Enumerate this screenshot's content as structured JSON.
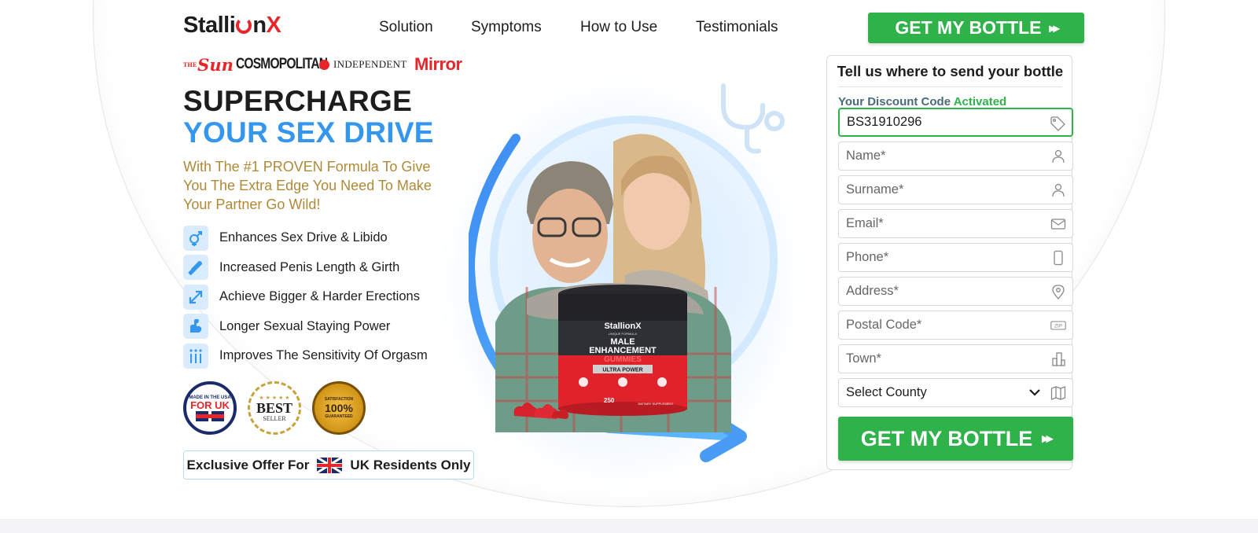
{
  "header": {
    "logo_main": "Stalli",
    "logo_o": "O",
    "logo_n": "n",
    "logo_x": "X",
    "nav": [
      "Solution",
      "Symptoms",
      "How to Use",
      "Testimonials"
    ],
    "cta_label": "GET MY BOTTLE",
    "cta_arrows": "▸▸"
  },
  "press": {
    "sun": "Sun",
    "cosmopolitan": "COSMOPOLITAN",
    "independent": "INDEPENDENT",
    "mirror": "Mirror"
  },
  "hero": {
    "headline_line1": "SUPERCHARGE",
    "headline_line2": "YOUR SEX DRIVE",
    "subheadline": "With The #1 PROVEN Formula To Give You The Extra Edge You Need To Make Your Partner Go Wild!",
    "benefits": [
      {
        "icon": "gender-icon",
        "label": "Enhances Sex Drive & Libido"
      },
      {
        "icon": "condom-icon",
        "label": "Increased Penis Length & Girth"
      },
      {
        "icon": "expand-arrow-icon",
        "label": "Achieve Bigger & Harder Erections"
      },
      {
        "icon": "muscle-arm-icon",
        "label": "Longer Sexual Staying Power"
      },
      {
        "icon": "sensitivity-icon",
        "label": "Improves The Sensitivity Of Orgasm"
      }
    ],
    "badges": {
      "uk_top": "MADE IN THE USA",
      "uk_main": "FOR UK",
      "best_stars": "★ ★ ★ ★ ★",
      "best_main": "BEST",
      "best_sub": "SELLER",
      "sat_top": "SATISFACTION",
      "sat_main": "100%",
      "sat_bottom": "GUARANTEED"
    },
    "offer_prefix": "Exclusive Offer For",
    "offer_suffix": "UK Residents Only"
  },
  "product": {
    "brand": "StallionX",
    "brand_sub": "UNIQUE FORMULA",
    "name_line1": "MALE",
    "name_line2": "ENHANCEMENT",
    "name_line3": "GUMMIES",
    "strength": "ULTRA POWER",
    "count": "250",
    "footer": "DIETARY SUPPLEMENT"
  },
  "form": {
    "title": "Tell us where to send your bottle",
    "discount_label": "Your Discount Code",
    "discount_status": "Activated",
    "discount_code": "BS31910296",
    "placeholders": {
      "name": "Name*",
      "surname": "Surname*",
      "email": "Email*",
      "phone": "Phone*",
      "address": "Address*",
      "postal": "Postal Code*",
      "town": "Town*"
    },
    "county_selected": "Select County",
    "submit_label": "GET MY BOTTLE",
    "submit_arrows": "▸▸",
    "zip_icon_text": "ZIP"
  },
  "colors": {
    "brand_green": "#2fb24a",
    "headline_blue": "#3596ee",
    "subheadline_gold": "#b08937",
    "press_red": "#e8262a"
  }
}
